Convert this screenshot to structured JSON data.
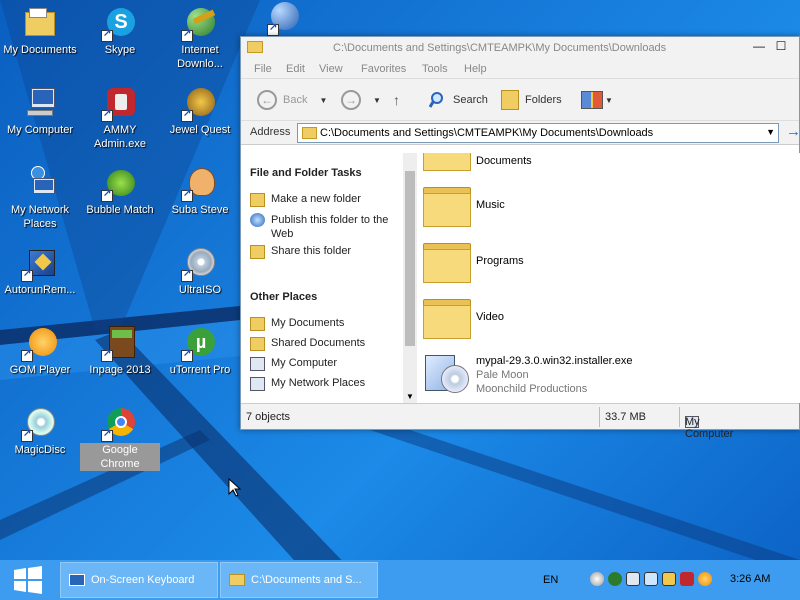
{
  "desktop": {
    "icons": [
      {
        "label": "My Documents"
      },
      {
        "label": "Skype"
      },
      {
        "label": "Internet Downlo..."
      },
      {
        "label": "My Computer"
      },
      {
        "label": "AMMY Admin.exe"
      },
      {
        "label": "Jewel Quest"
      },
      {
        "label": "My Network Places"
      },
      {
        "label": "Bubble Match"
      },
      {
        "label": "Suba Steve"
      },
      {
        "label": "AutorunRem..."
      },
      {
        "label": "UltraISO"
      },
      {
        "label": "GOM Player"
      },
      {
        "label": "Inpage 2013"
      },
      {
        "label": "uTorrent Pro"
      },
      {
        "label": "MagicDisc"
      },
      {
        "label": "Google Chrome"
      }
    ]
  },
  "window": {
    "title": "C:\\Documents and Settings\\CMTEAMPK\\My Documents\\Downloads",
    "menu": [
      "File",
      "Edit",
      "View",
      "Favorites",
      "Tools",
      "Help"
    ],
    "toolbar": {
      "back": "Back",
      "search": "Search",
      "folders": "Folders"
    },
    "address": {
      "label": "Address",
      "value": "C:\\Documents and Settings\\CMTEAMPK\\My Documents\\Downloads"
    },
    "tasks": {
      "file_folder_title": "File and Folder Tasks",
      "file_folder_items": [
        "Make a new folder",
        "Publish this folder to the Web",
        "Share this folder"
      ],
      "other_title": "Other Places",
      "other_items": [
        "My Documents",
        "Shared Documents",
        "My Computer",
        "My Network Places"
      ]
    },
    "files": [
      {
        "name": "Documents"
      },
      {
        "name": "Music"
      },
      {
        "name": "Programs"
      },
      {
        "name": "Video"
      }
    ],
    "exe": {
      "name": "mypal-29.3.0.win32.installer.exe",
      "line2": "Pale Moon",
      "line3": "Moonchild Productions"
    },
    "status": {
      "objects": "7 objects",
      "size": "33.7 MB",
      "location": "My Computer"
    }
  },
  "taskbar": {
    "buttons": [
      {
        "label": "On-Screen Keyboard"
      },
      {
        "label": "C:\\Documents and S..."
      }
    ],
    "lang": "EN",
    "clock": "3:26 AM"
  },
  "colors": {
    "taskbar": "#3e9cf0",
    "desktop": "#1577d6",
    "folder": "#f7da7c"
  }
}
